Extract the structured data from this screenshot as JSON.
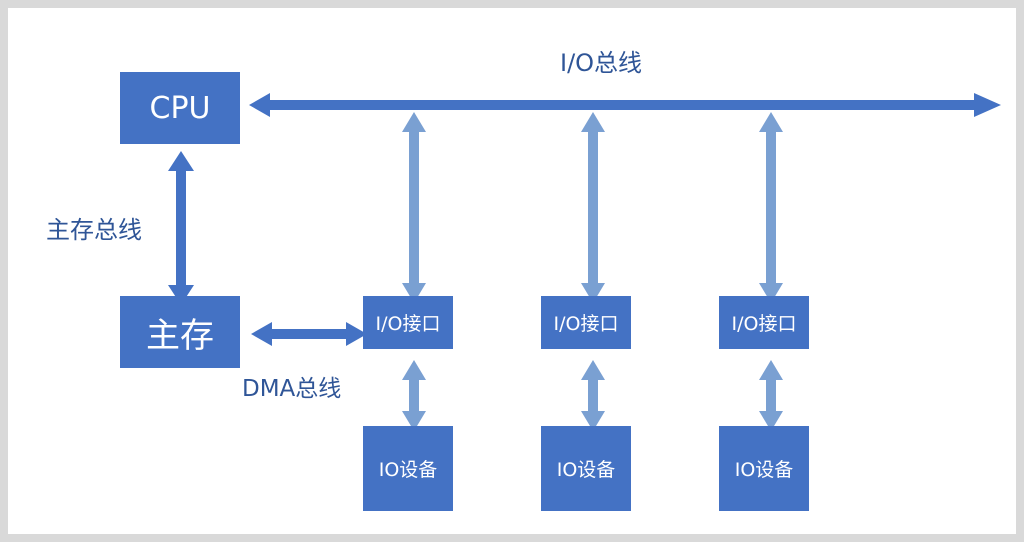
{
  "nodes": {
    "cpu": "CPU",
    "memory": "主存",
    "io_interfaces": [
      "I/O接口",
      "I/O接口",
      "I/O接口"
    ],
    "io_devices": [
      "IO设备",
      "IO设备",
      "IO设备"
    ]
  },
  "labels": {
    "io_bus": "I/O总线",
    "memory_bus": "主存总线",
    "dma_bus": "DMA总线"
  },
  "colors": {
    "box": "#4472c4",
    "bus_main": "#4472c4",
    "bus_light": "#7aa0d2",
    "label_text": "#2f5597"
  }
}
